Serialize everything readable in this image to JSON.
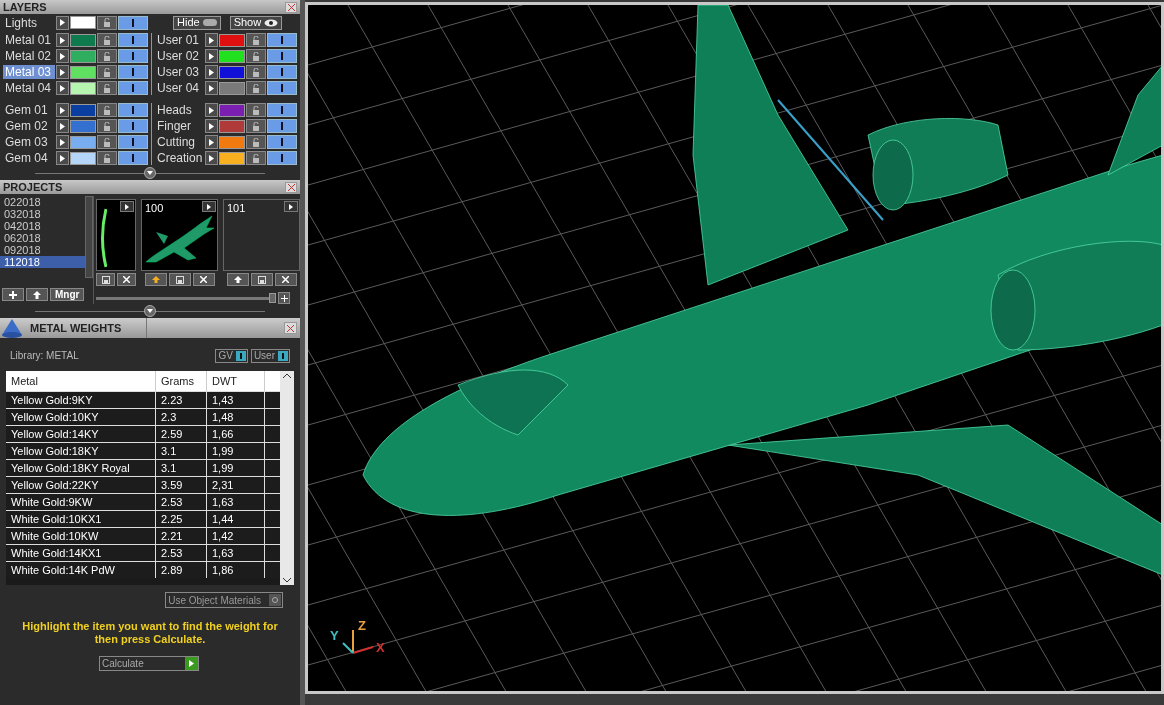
{
  "layers": {
    "title": "LAYERS",
    "lights": {
      "name": "Lights",
      "color": "#ffffff",
      "visible": true
    },
    "hide_label": "Hide",
    "show_label": "Show",
    "groups": [
      {
        "items": [
          {
            "name": "Metal 01",
            "color": "#0f7a4e",
            "selected": false,
            "visible": true
          },
          {
            "name": "Metal 02",
            "color": "#2fae5f",
            "selected": false,
            "visible": true
          },
          {
            "name": "Metal 03",
            "color": "#5fe060",
            "selected": true,
            "visible": true
          },
          {
            "name": "Metal 04",
            "color": "#b6f5b0",
            "selected": false,
            "visible": true
          }
        ]
      },
      {
        "items": [
          {
            "name": "User 01",
            "color": "#e01010",
            "selected": false,
            "visible": true
          },
          {
            "name": "User 02",
            "color": "#20e020",
            "selected": false,
            "visible": true
          },
          {
            "name": "User 03",
            "color": "#1010d8",
            "selected": false,
            "visible": true
          },
          {
            "name": "User 04",
            "color": "#7a7a7a",
            "selected": false,
            "visible": true
          }
        ]
      },
      {
        "items": [
          {
            "name": "Gem 01",
            "color": "#0a3ea0",
            "selected": false,
            "visible": true
          },
          {
            "name": "Gem 02",
            "color": "#3470d0",
            "selected": false,
            "visible": true
          },
          {
            "name": "Gem 03",
            "color": "#78aef0",
            "selected": false,
            "visible": true
          },
          {
            "name": "Gem 04",
            "color": "#b4d4f8",
            "selected": false,
            "visible": true
          }
        ]
      },
      {
        "items": [
          {
            "name": "Heads",
            "color": "#7b1fb0",
            "selected": false,
            "visible": true
          },
          {
            "name": "Finger",
            "color": "#b03a3a",
            "selected": false,
            "visible": true
          },
          {
            "name": "Cutting",
            "color": "#f07a10",
            "selected": false,
            "visible": true
          },
          {
            "name": "Creation",
            "color": "#f8b020",
            "selected": false,
            "visible": true
          }
        ]
      }
    ]
  },
  "projects": {
    "title": "PROJECTS",
    "list": [
      {
        "label": "022018",
        "selected": false
      },
      {
        "label": "032018",
        "selected": false
      },
      {
        "label": "042018",
        "selected": false
      },
      {
        "label": "062018",
        "selected": false
      },
      {
        "label": "092018",
        "selected": false
      },
      {
        "label": "112018",
        "selected": true
      }
    ],
    "thumbnails": [
      {
        "kind": "partial"
      },
      {
        "label": "100",
        "kind": "plane"
      },
      {
        "label": "101",
        "kind": "empty"
      }
    ],
    "manager_button": "Mngr"
  },
  "metal_weights": {
    "title": "METAL WEIGHTS",
    "library": "Library: METAL",
    "toggles": [
      {
        "label": "GV",
        "on": true
      },
      {
        "label": "User",
        "on": true
      }
    ],
    "columns": [
      "Metal",
      "Grams",
      "DWT"
    ],
    "rows": [
      [
        "Yellow Gold:9KY",
        "2.23",
        "1,43"
      ],
      [
        "Yellow Gold:10KY",
        "2.3",
        "1,48"
      ],
      [
        "Yellow Gold:14KY",
        "2.59",
        "1,66"
      ],
      [
        "Yellow Gold:18KY",
        "3.1",
        "1,99"
      ],
      [
        "Yellow Gold:18KY Royal",
        "3.1",
        "1,99"
      ],
      [
        "Yellow Gold:22KY",
        "3.59",
        "2,31"
      ],
      [
        "White Gold:9KW",
        "2.53",
        "1,63"
      ],
      [
        "White Gold:10KX1",
        "2.25",
        "1,44"
      ],
      [
        "White Gold:10KW",
        "2.21",
        "1,42"
      ],
      [
        "White Gold:14KX1",
        "2.53",
        "1,63"
      ],
      [
        "White Gold:14K PdW",
        "2.89",
        "1,86"
      ]
    ],
    "use_object_materials": {
      "label": "Use Object Materials",
      "checked": false
    },
    "hint": "Highlight the item you want to find the weight for then press Calculate.",
    "calculate_button": "Calculate"
  },
  "viewport": {
    "axes": [
      {
        "label": "Z",
        "color": "#e8a040"
      },
      {
        "label": "X",
        "color": "#d03030"
      },
      {
        "label": "Y",
        "color": "#40c0c0"
      }
    ]
  }
}
